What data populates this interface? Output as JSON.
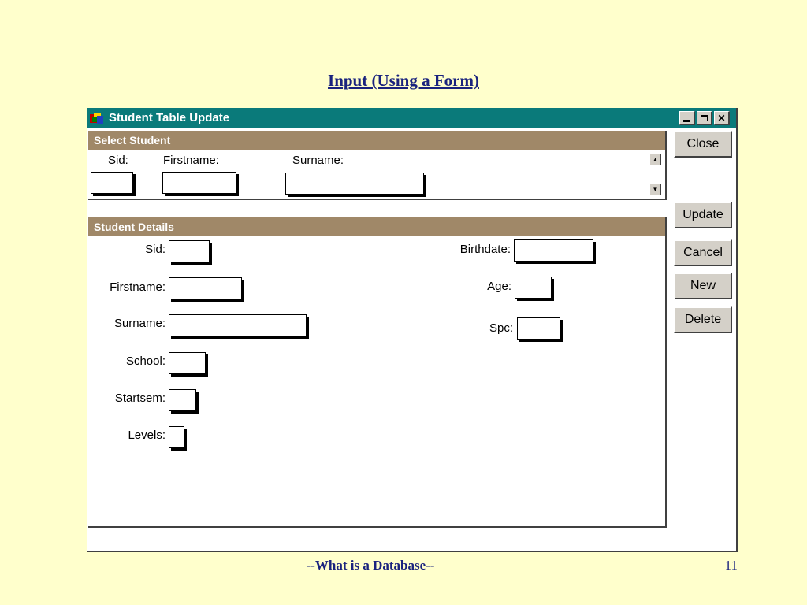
{
  "slide": {
    "title": "Input (Using a Form)",
    "footer": "--What is a Database--",
    "page_number": "11"
  },
  "window": {
    "title": "Student Table Update",
    "app_icon": "access-app-icon",
    "controls": [
      "minimize-icon",
      "maximize-icon",
      "close-icon"
    ]
  },
  "select_student": {
    "header": "Select Student",
    "sid_label": "Sid:",
    "firstname_label": "Firstname:",
    "surname_label": "Surname:",
    "sid_value": "",
    "firstname_value": "",
    "surname_value": ""
  },
  "details": {
    "header": "Student Details",
    "sid_label": "Sid:",
    "firstname_label": "Firstname:",
    "surname_label": "Surname:",
    "school_label": "School:",
    "startsem_label": "Startsem:",
    "levels_label": "Levels:",
    "birthdate_label": "Birthdate:",
    "age_label": "Age:",
    "spc_label": "Spc:",
    "values": {
      "sid": "",
      "firstname": "",
      "surname": "",
      "school": "",
      "startsem": "",
      "levels": "",
      "birthdate": "",
      "age": "",
      "spc": ""
    }
  },
  "buttons": {
    "close": "Close",
    "update": "Update",
    "cancel": "Cancel",
    "new": "New",
    "delete": "Delete"
  }
}
